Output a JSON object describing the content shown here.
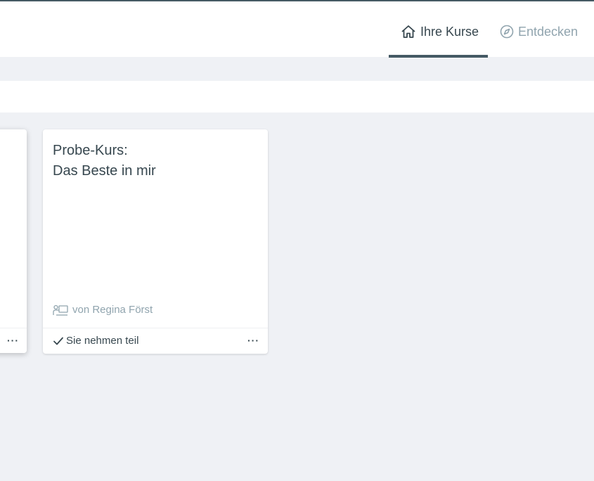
{
  "nav": {
    "items": [
      {
        "label": "Ihre Kurse",
        "icon": "home-icon",
        "active": true
      },
      {
        "label": "Entdecken",
        "icon": "compass-icon",
        "active": false
      }
    ]
  },
  "courses": [
    {
      "title_lines": [
        "Probe-Kurs:",
        "Das Beste in mir"
      ],
      "author": "von Regina Först",
      "author_icon": "teacher-icon",
      "status": "Sie nehmen teil",
      "status_icon": "check-icon",
      "more_label": "···"
    }
  ],
  "partial_card": {
    "more_label": "···"
  },
  "colors": {
    "accent": "#455a64",
    "text": "#37474f",
    "muted": "#90a4ae",
    "background": "#eff1f5"
  }
}
